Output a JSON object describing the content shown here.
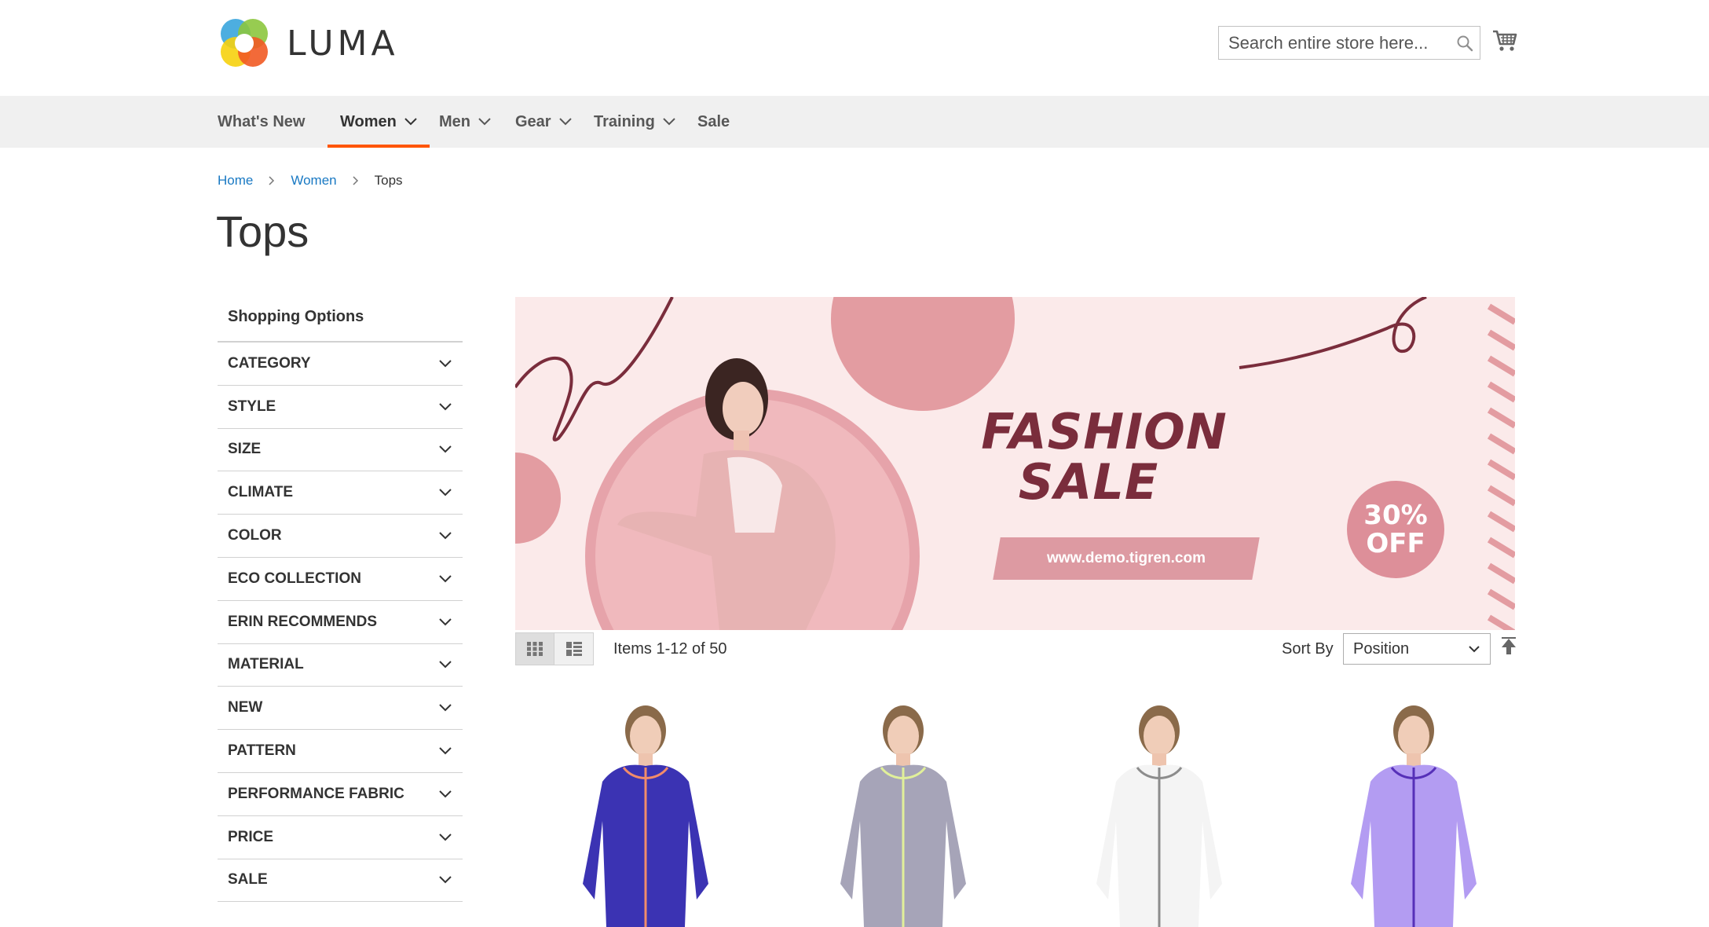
{
  "header": {
    "logo_text": "LUMA",
    "search_placeholder": "Search entire store here...",
    "cart_icon": "cart-icon"
  },
  "nav": {
    "items": [
      {
        "label": "What's New",
        "has_dropdown": false,
        "active": false
      },
      {
        "label": "Women",
        "has_dropdown": true,
        "active": true
      },
      {
        "label": "Men",
        "has_dropdown": true,
        "active": false
      },
      {
        "label": "Gear",
        "has_dropdown": true,
        "active": false
      },
      {
        "label": "Training",
        "has_dropdown": true,
        "active": false
      },
      {
        "label": "Sale",
        "has_dropdown": false,
        "active": false
      }
    ],
    "active_color": "#ff5501"
  },
  "breadcrumb": {
    "items": [
      "Home",
      "Women"
    ],
    "current": "Tops"
  },
  "page_title": "Tops",
  "sidebar": {
    "title": "Shopping Options",
    "filters": [
      "CATEGORY",
      "STYLE",
      "SIZE",
      "CLIMATE",
      "COLOR",
      "ECO COLLECTION",
      "ERIN RECOMMENDS",
      "MATERIAL",
      "NEW",
      "PATTERN",
      "PERFORMANCE FABRIC",
      "PRICE",
      "SALE"
    ]
  },
  "banner": {
    "title_line1": "FASHION",
    "title_line2": "SALE",
    "url": "www.demo.tigren.com",
    "badge_line1": "30%",
    "badge_line2": "OFF"
  },
  "toolbar": {
    "amount": "Items 1-12 of 50",
    "sort_label": "Sort By",
    "sort_value": "Position"
  },
  "products": [
    {
      "color": "#3b33b3",
      "accent": "#f28c6a"
    },
    {
      "color": "#a6a4b8",
      "accent": "#e1f09a"
    },
    {
      "color": "#f4f4f4",
      "accent": "#8c8c8c"
    },
    {
      "color": "#b39cf2",
      "accent": "#5630b8"
    }
  ]
}
